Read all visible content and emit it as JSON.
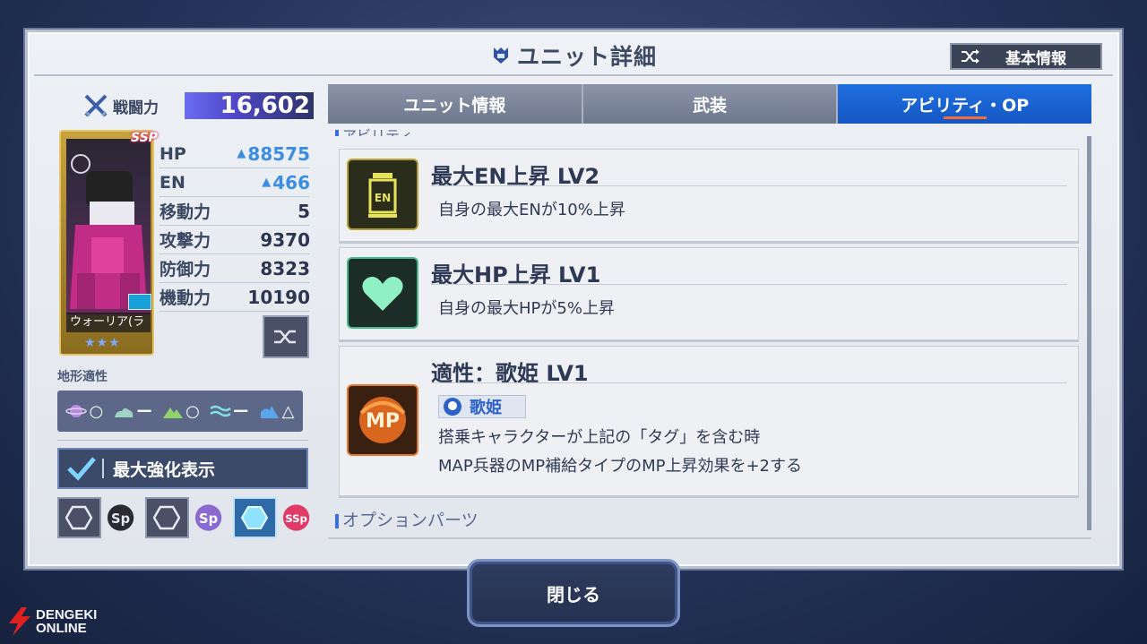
{
  "window": {
    "title": "ユニット詳細",
    "title_icon": "unit-emblem-icon"
  },
  "header": {
    "basic_info_label": "基本情報",
    "basic_info_icon": "shuffle-icon"
  },
  "left_panel": {
    "power_label": "戦闘力",
    "power_value": "16,602",
    "card": {
      "name": "ウォーリア(ラ",
      "rarity_badge": "SSP",
      "stars": "★★★"
    },
    "stats": [
      {
        "label": "HP",
        "value": "88575",
        "boosted": true
      },
      {
        "label": "EN",
        "value": "466",
        "boosted": true
      },
      {
        "label": "移動力",
        "value": "5",
        "boosted": false
      },
      {
        "label": "攻撃力",
        "value": "9370",
        "boosted": false
      },
      {
        "label": "防御力",
        "value": "8323",
        "boosted": false
      },
      {
        "label": "機動力",
        "value": "10190",
        "boosted": false
      }
    ],
    "terrain_label": "地形適性",
    "terrain": [
      {
        "icon": "space-icon",
        "grade": "○"
      },
      {
        "icon": "air-icon",
        "grade": "ー"
      },
      {
        "icon": "land-icon",
        "grade": "○"
      },
      {
        "icon": "sea-icon",
        "grade": "ー"
      },
      {
        "icon": "underwater-icon",
        "grade": "△"
      }
    ],
    "max_enhance_label": "最大強化表示",
    "slots": [
      {
        "icon": "hexagon-icon",
        "badge": "SP"
      },
      {
        "icon": "hexagon-icon",
        "badge": "SP"
      },
      {
        "icon": "hexagon-filled-icon",
        "badge": "SSP"
      }
    ]
  },
  "tabs": [
    {
      "label": "ユニット情報",
      "active": false
    },
    {
      "label": "武装",
      "active": false
    },
    {
      "label": "アビリティ・OP",
      "active": true
    }
  ],
  "content": {
    "section_abilities": "アビリティ",
    "abilities": [
      {
        "title": "最大EN上昇 LV2",
        "icon": "en-canister-icon",
        "desc": [
          "自身の最大ENが10%上昇"
        ]
      },
      {
        "title": "最大HP上昇 LV1",
        "icon": "heart-icon",
        "desc": [
          "自身の最大HPが5%上昇"
        ]
      },
      {
        "title": "適性：歌姫 LV1",
        "icon": "mp-icon",
        "tag": "歌姫",
        "desc": [
          "搭乗キャラクターが上記の「タグ」を含む時",
          "MAP兵器のMP補給タイプのMP上昇効果を+2する"
        ]
      }
    ],
    "section_options": "オプションパーツ"
  },
  "footer": {
    "close_label": "閉じる"
  },
  "watermark": {
    "line1": "DENGEKI",
    "line2": "ONLINE"
  },
  "colors": {
    "accent_blue": "#1f6ee0",
    "tab_gray": "#7b8499",
    "power_purple": "#6a6df0",
    "stat_up": "#3b8de0"
  }
}
